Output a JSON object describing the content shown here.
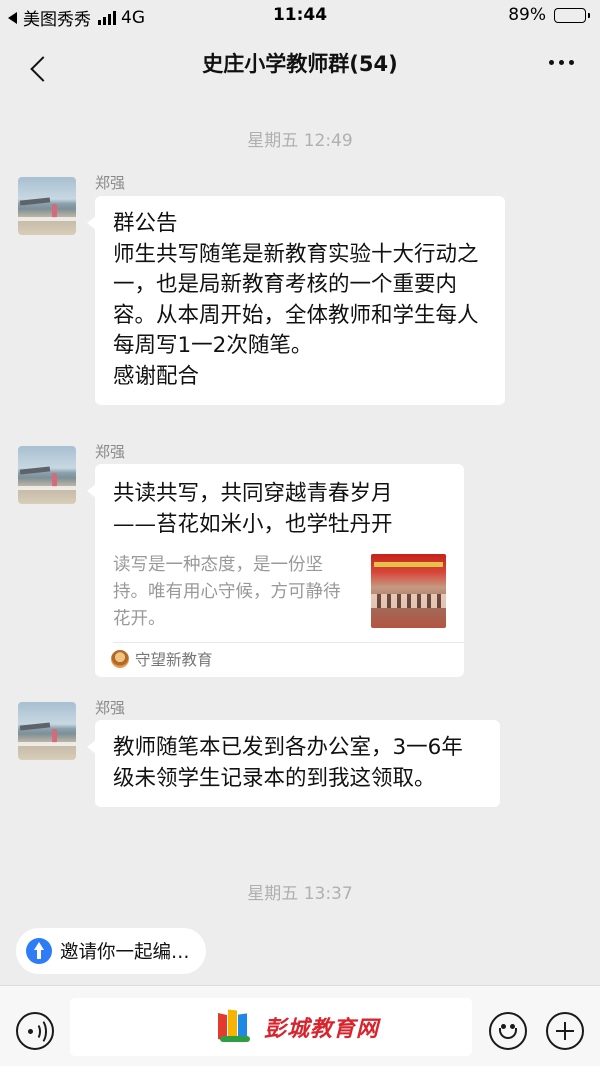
{
  "status_bar": {
    "carrier": "美图秀秀",
    "network": "4G",
    "time": "11:44",
    "battery": "89%",
    "battery_level": 0.89
  },
  "nav": {
    "title": "史庄小学教师群(54)"
  },
  "messages": [
    {
      "time_label": "星期五 12:49",
      "sender": "郑强",
      "text": "群公告\n师生共写随笔是新教育实验十大行动之一，也是局新教育考核的一个重要内容。从本周开始，全体教师和学生每人每周写1一2次随笔。\n感谢配合"
    },
    {
      "sender": "郑强",
      "card_title": "共读共写，共同穿越青春岁月\n——苔花如米小，也学牡丹开",
      "card_desc": "读写是一种态度，是一份坚持。唯有用心守候，方可静待花开。",
      "card_source": "守望新教育"
    },
    {
      "sender": "郑强",
      "text": "教师随笔本已发到各办公室，3一6年级未领学生记录本的到我这领取。"
    }
  ],
  "footer_time_label": "星期五 13:37",
  "invite": {
    "label": "邀请你一起编…"
  },
  "toolbar": {
    "watermark": "彭城教育网"
  }
}
